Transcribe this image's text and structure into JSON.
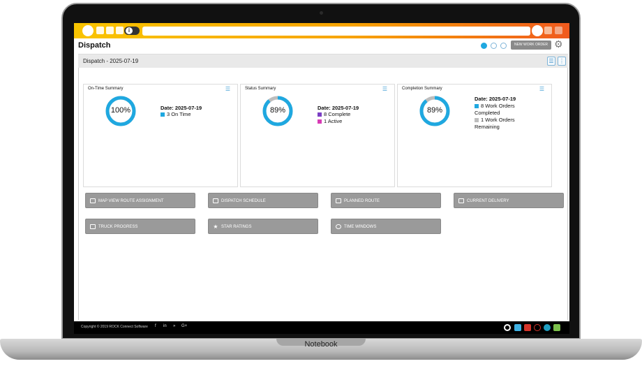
{
  "device": {
    "brand_label": "Notebook"
  },
  "topbar": {
    "search_placeholder": ""
  },
  "header": {
    "title": "Dispatch",
    "new_work_order_label": "NEW WORK ORDER"
  },
  "subbar": {
    "title": "Dispatch - 2025-07-19"
  },
  "cards": [
    {
      "title": "On-Time Summary",
      "percent_label": "100%",
      "percent_value": 1.0,
      "date": "Date: 2025-07-19",
      "legend": [
        {
          "text": "3 On Time",
          "color": "#1fa8e0"
        }
      ]
    },
    {
      "title": "Status Summary",
      "percent_label": "89%",
      "percent_value": 0.89,
      "date": "Date: 2025-07-19",
      "legend": [
        {
          "text": "8 Complete",
          "color": "#7b3fc4"
        },
        {
          "text": "1 Active",
          "color": "#d83bb5"
        }
      ]
    },
    {
      "title": "Completion Summary",
      "percent_label": "89%",
      "percent_value": 0.89,
      "date": "Date: 2025-07-19",
      "legend": [
        {
          "text": "8 Work Orders",
          "text2": "Completed",
          "color": "#1fa8e0"
        },
        {
          "text": "1 Work Orders",
          "text2": "Remaining",
          "color": "#bdbdbd"
        }
      ]
    }
  ],
  "nav_buttons": [
    {
      "label": "MAP VIEW ROUTE ASSIGNMENT",
      "icon": "map-icon"
    },
    {
      "label": "DISPATCH SCHEDULE",
      "icon": "truck-schedule-icon"
    },
    {
      "label": "PLANNED ROUTE",
      "icon": "route-icon"
    },
    {
      "label": "CURRENT DELIVERY",
      "icon": "delivery-icon"
    },
    {
      "label": "TRUCK PROGRESS",
      "icon": "truck-icon"
    },
    {
      "label": "STAR RATINGS",
      "icon": "star-icon"
    },
    {
      "label": "TIME WINDOWS",
      "icon": "clock-icon"
    }
  ],
  "footer": {
    "copyright": "Copyright © 2019 ROCK Connect Software",
    "social": [
      "f",
      "in",
      "»",
      "G+"
    ]
  },
  "colors": {
    "accent_blue": "#1fa8e0",
    "donut_track": "#bdbdbd",
    "button_gray": "#9a9a9a",
    "topbar_start": "#f9c400",
    "topbar_end": "#f05a1e"
  }
}
